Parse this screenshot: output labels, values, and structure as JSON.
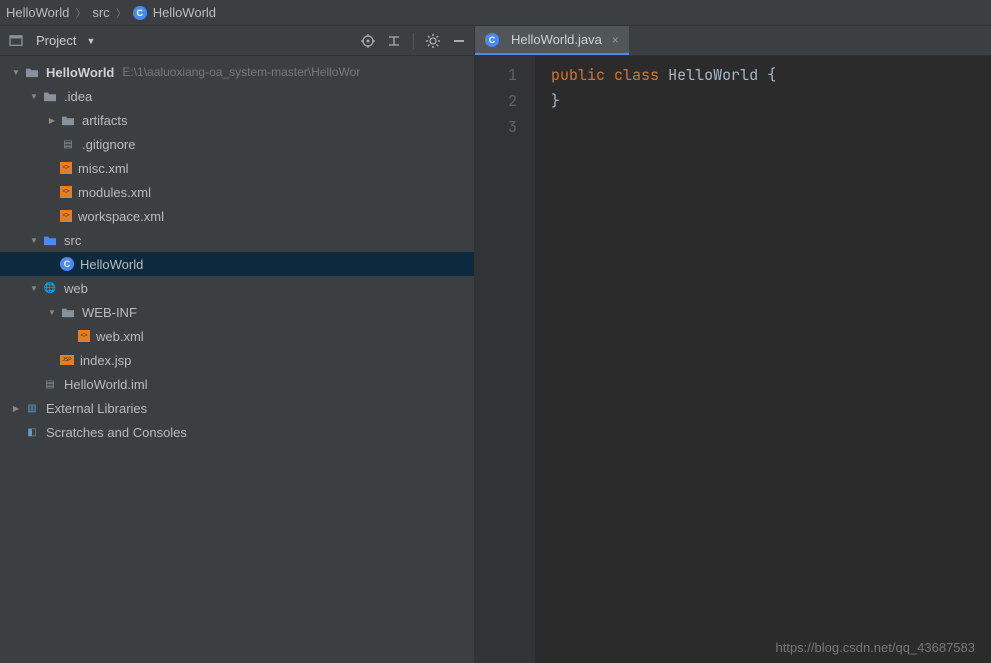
{
  "breadcrumb": {
    "items": [
      "HelloWorld",
      "src",
      "HelloWorld"
    ]
  },
  "sidebar": {
    "title": "Project",
    "project_name": "HelloWorld",
    "project_path": "E:\\1\\aaluoxiang-oa_system-master\\HelloWor",
    "tree": {
      "idea": ".idea",
      "artifacts": "artifacts",
      "gitignore": ".gitignore",
      "misc": "misc.xml",
      "modules": "modules.xml",
      "workspace": "workspace.xml",
      "src": "src",
      "helloworld_class": "HelloWorld",
      "web": "web",
      "webinf": "WEB-INF",
      "webxml": "web.xml",
      "indexjsp": "index.jsp",
      "iml": "HelloWorld.iml",
      "extlib": "External Libraries",
      "scratch": "Scratches and Consoles"
    }
  },
  "editor": {
    "tab_label": "HelloWorld.java",
    "gutter": [
      "1",
      "2",
      "3"
    ],
    "code": {
      "kw_public": "public",
      "kw_class": "class",
      "name": "HelloWorld",
      "open": "{",
      "close": "}"
    }
  },
  "watermark": "https://blog.csdn.net/qq_43687583"
}
